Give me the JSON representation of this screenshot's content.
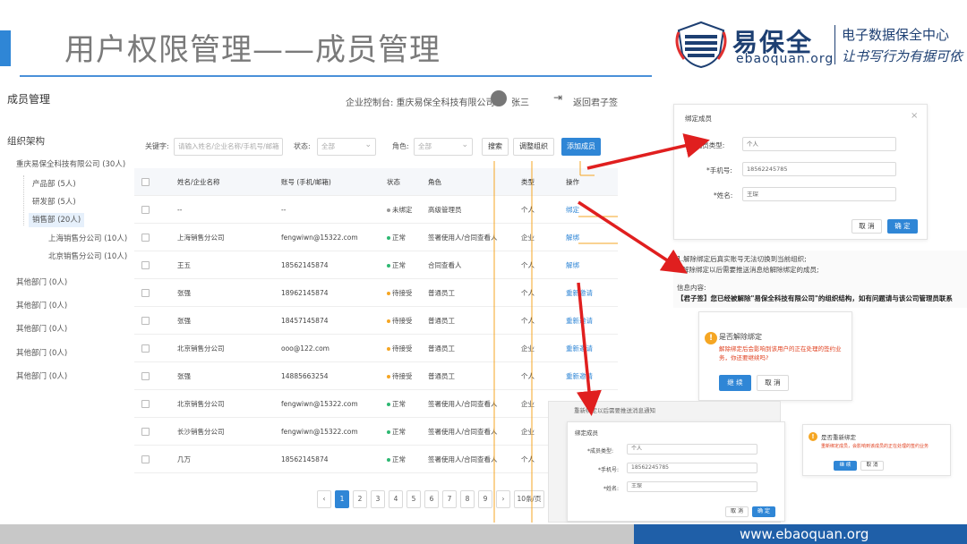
{
  "slide": {
    "title": "用户权限管理——成员管理",
    "logo": {
      "name": "易保全",
      "domain": "ebaoquan.org",
      "center": "电子数据保全中心",
      "slogan": "让书写行为有据可依"
    },
    "footer_url": "www.ebaoquan.org"
  },
  "app": {
    "title": "成员管理",
    "header": {
      "company": "企业控制台: 重庆易保全科技有限公司",
      "user": "张三",
      "back": "返回君子签"
    },
    "org": {
      "title": "组织架构",
      "items": [
        "重庆易保全科技有限公司 (30人)",
        "产品部 (5人)",
        "研发部 (5人)",
        "销售部 (20人)",
        "上海销售分公司 (10人)",
        "北京销售分公司 (10人)",
        "其他部门 (0人)",
        "其他部门 (0人)",
        "其他部门 (0人)",
        "其他部门 (0人)",
        "其他部门 (0人)"
      ]
    },
    "filter": {
      "keyword_label": "关键字:",
      "keyword_placeholder": "请输入姓名/企业名称/手机号/邮箱",
      "status_label": "状态:",
      "status_value": "全部",
      "role_label": "角色:",
      "role_value": "全部",
      "search": "搜索",
      "adjust": "调整组织",
      "add": "添加成员"
    },
    "table": {
      "headers": [
        "姓名/企业名称",
        "账号 (手机/邮箱)",
        "状态",
        "角色",
        "类型",
        "操作"
      ],
      "rows": [
        {
          "name": "--",
          "account": "--",
          "status": "未绑定",
          "role": "高级管理员",
          "type": "个人",
          "action": "绑定"
        },
        {
          "name": "上海销售分公司",
          "account": "fengwiwn@15322.com",
          "status": "正常",
          "role": "签署使用人/合同查看人",
          "type": "企业",
          "action": "解绑"
        },
        {
          "name": "王五",
          "account": "18562145874",
          "status": "正常",
          "role": "合同查看人",
          "type": "个人",
          "action": "解绑"
        },
        {
          "name": "张强",
          "account": "18962145874",
          "status": "待接受",
          "role": "普通员工",
          "type": "个人",
          "action": "重新邀请"
        },
        {
          "name": "张强",
          "account": "18457145874",
          "status": "待接受",
          "role": "普通员工",
          "type": "个人",
          "action": "重新邀请"
        },
        {
          "name": "北京销售分公司",
          "account": "ooo@122.com",
          "status": "待接受",
          "role": "普通员工",
          "type": "企业",
          "action": "重新邀请"
        },
        {
          "name": "张强",
          "account": "14885663254",
          "status": "待接受",
          "role": "普通员工",
          "type": "个人",
          "action": "重新邀请"
        },
        {
          "name": "北京销售分公司",
          "account": "fengwiwn@15322.com",
          "status": "正常",
          "role": "签署使用人/合同查看人",
          "type": "企业",
          "action": ""
        },
        {
          "name": "长沙销售分公司",
          "account": "fengwiwn@15322.com",
          "status": "正常",
          "role": "签署使用人/合同查看人",
          "type": "企业",
          "action": ""
        },
        {
          "name": "几万",
          "account": "18562145874",
          "status": "正常",
          "role": "签署使用人/合同查看人",
          "type": "个人",
          "action": ""
        }
      ]
    },
    "pagination": {
      "prev": "‹",
      "pages": [
        "1",
        "2",
        "3",
        "4",
        "5",
        "6",
        "7",
        "8",
        "9"
      ],
      "next": "›",
      "page_size": "10条/页"
    }
  },
  "bind_dialog": {
    "title": "绑定成员",
    "type_label": "*成员类型:",
    "type_value": "个人",
    "phone_label": "*手机号:",
    "phone_value": "18562245785",
    "name_label": "*姓名:",
    "name_value": "王琛",
    "cancel": "取 消",
    "ok": "确 定"
  },
  "unbind_notice": {
    "line1": "1.解除绑定后真实账号无法切换到当前组织;",
    "line2": "解除绑定以后需要推送消息给解除绑定的成员;",
    "info_label": "信息内容:",
    "info_text": "【君子签】您已经被解除\"易保全科技有限公司\"的组织结构，如有问题请与该公司管理员联系"
  },
  "confirm_dialog": {
    "title": "是否解除绑定",
    "message": "解除绑定后会影响到该用户的正在处理的签约业务，你还要继续吗?",
    "ok": "继 续",
    "cancel": "取 消"
  },
  "rebind_note": "重新绑定以后需要推送消息通知",
  "rebind_dialog": {
    "title": "绑定成员",
    "type_label": "*成员类型:",
    "type_value": "个人",
    "phone_label": "*手机号:",
    "phone_value": "18562245785",
    "name_label": "*姓名:",
    "name_value": "王琛",
    "cancel": "取 消",
    "ok": "确 定"
  },
  "small_confirm": {
    "title": "是否重新绑定",
    "message": "重新绑定成员，会影响到该成员的正在处理的签约业务",
    "ok": "继 续",
    "cancel": "取 消"
  },
  "colors": {
    "accent": "#2f86d6",
    "arrow": "#e01f1f",
    "footer_blue": "#1f5fa8",
    "status_normal": "#2eb872",
    "status_pending": "#f5a623",
    "status_unbound": "#999999"
  }
}
